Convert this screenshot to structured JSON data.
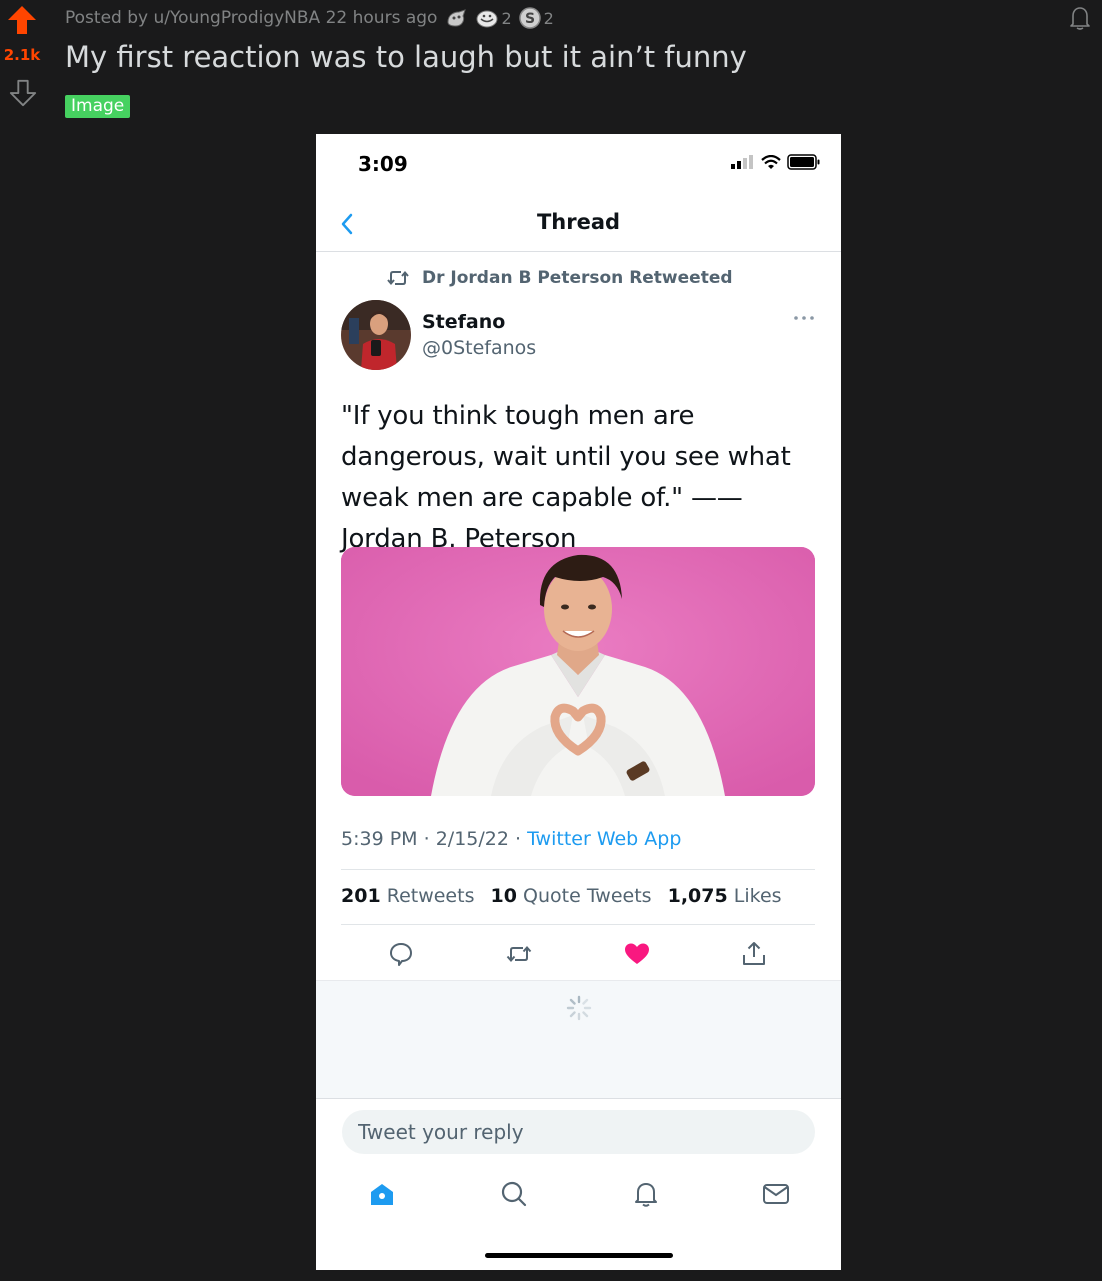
{
  "post": {
    "vote_count": "2.1k",
    "meta_text": "Posted by u/YoungProdigyNBA 22 hours ago",
    "awards": [
      {
        "icon": "wholesome-award-icon",
        "count": ""
      },
      {
        "icon": "helpful-award-icon",
        "count": "2"
      },
      {
        "icon": "silver-award-icon",
        "count": "2"
      }
    ],
    "title": "My first reaction was to laugh but it ain’t funny",
    "flair": "Image",
    "colors": {
      "upvote": "#ff4500",
      "flair_bg": "#46d160",
      "background": "#1a1a1b"
    }
  },
  "phone": {
    "status_time": "3:09",
    "header_title": "Thread",
    "retweeted_by": "Dr Jordan B Peterson Retweeted",
    "author": {
      "name": "Stefano",
      "handle": "@0Stefanos"
    },
    "tweet_text": "\"If you think tough men are dangerous, wait until you see what weak men are capable of.\" —— Jordan B. Peterson",
    "tweet_meta": {
      "time": "5:39 PM",
      "separator": "·",
      "date": "2/15/22",
      "source": "Twitter Web App"
    },
    "stats": {
      "retweets_count": "201",
      "retweets_label": "Retweets",
      "quotes_count": "10",
      "quotes_label": "Quote Tweets",
      "likes_count": "1,075",
      "likes_label": "Likes"
    },
    "actions": [
      "reply-icon",
      "retweet-icon",
      "heart-icon",
      "share-icon"
    ],
    "reply_placeholder": "Tweet your reply",
    "tabs": [
      "home-icon",
      "search-icon",
      "notifications-icon",
      "messages-icon"
    ],
    "colors": {
      "link": "#1d9bf0",
      "like": "#f91880",
      "image_bg": "#e06ab5"
    }
  }
}
